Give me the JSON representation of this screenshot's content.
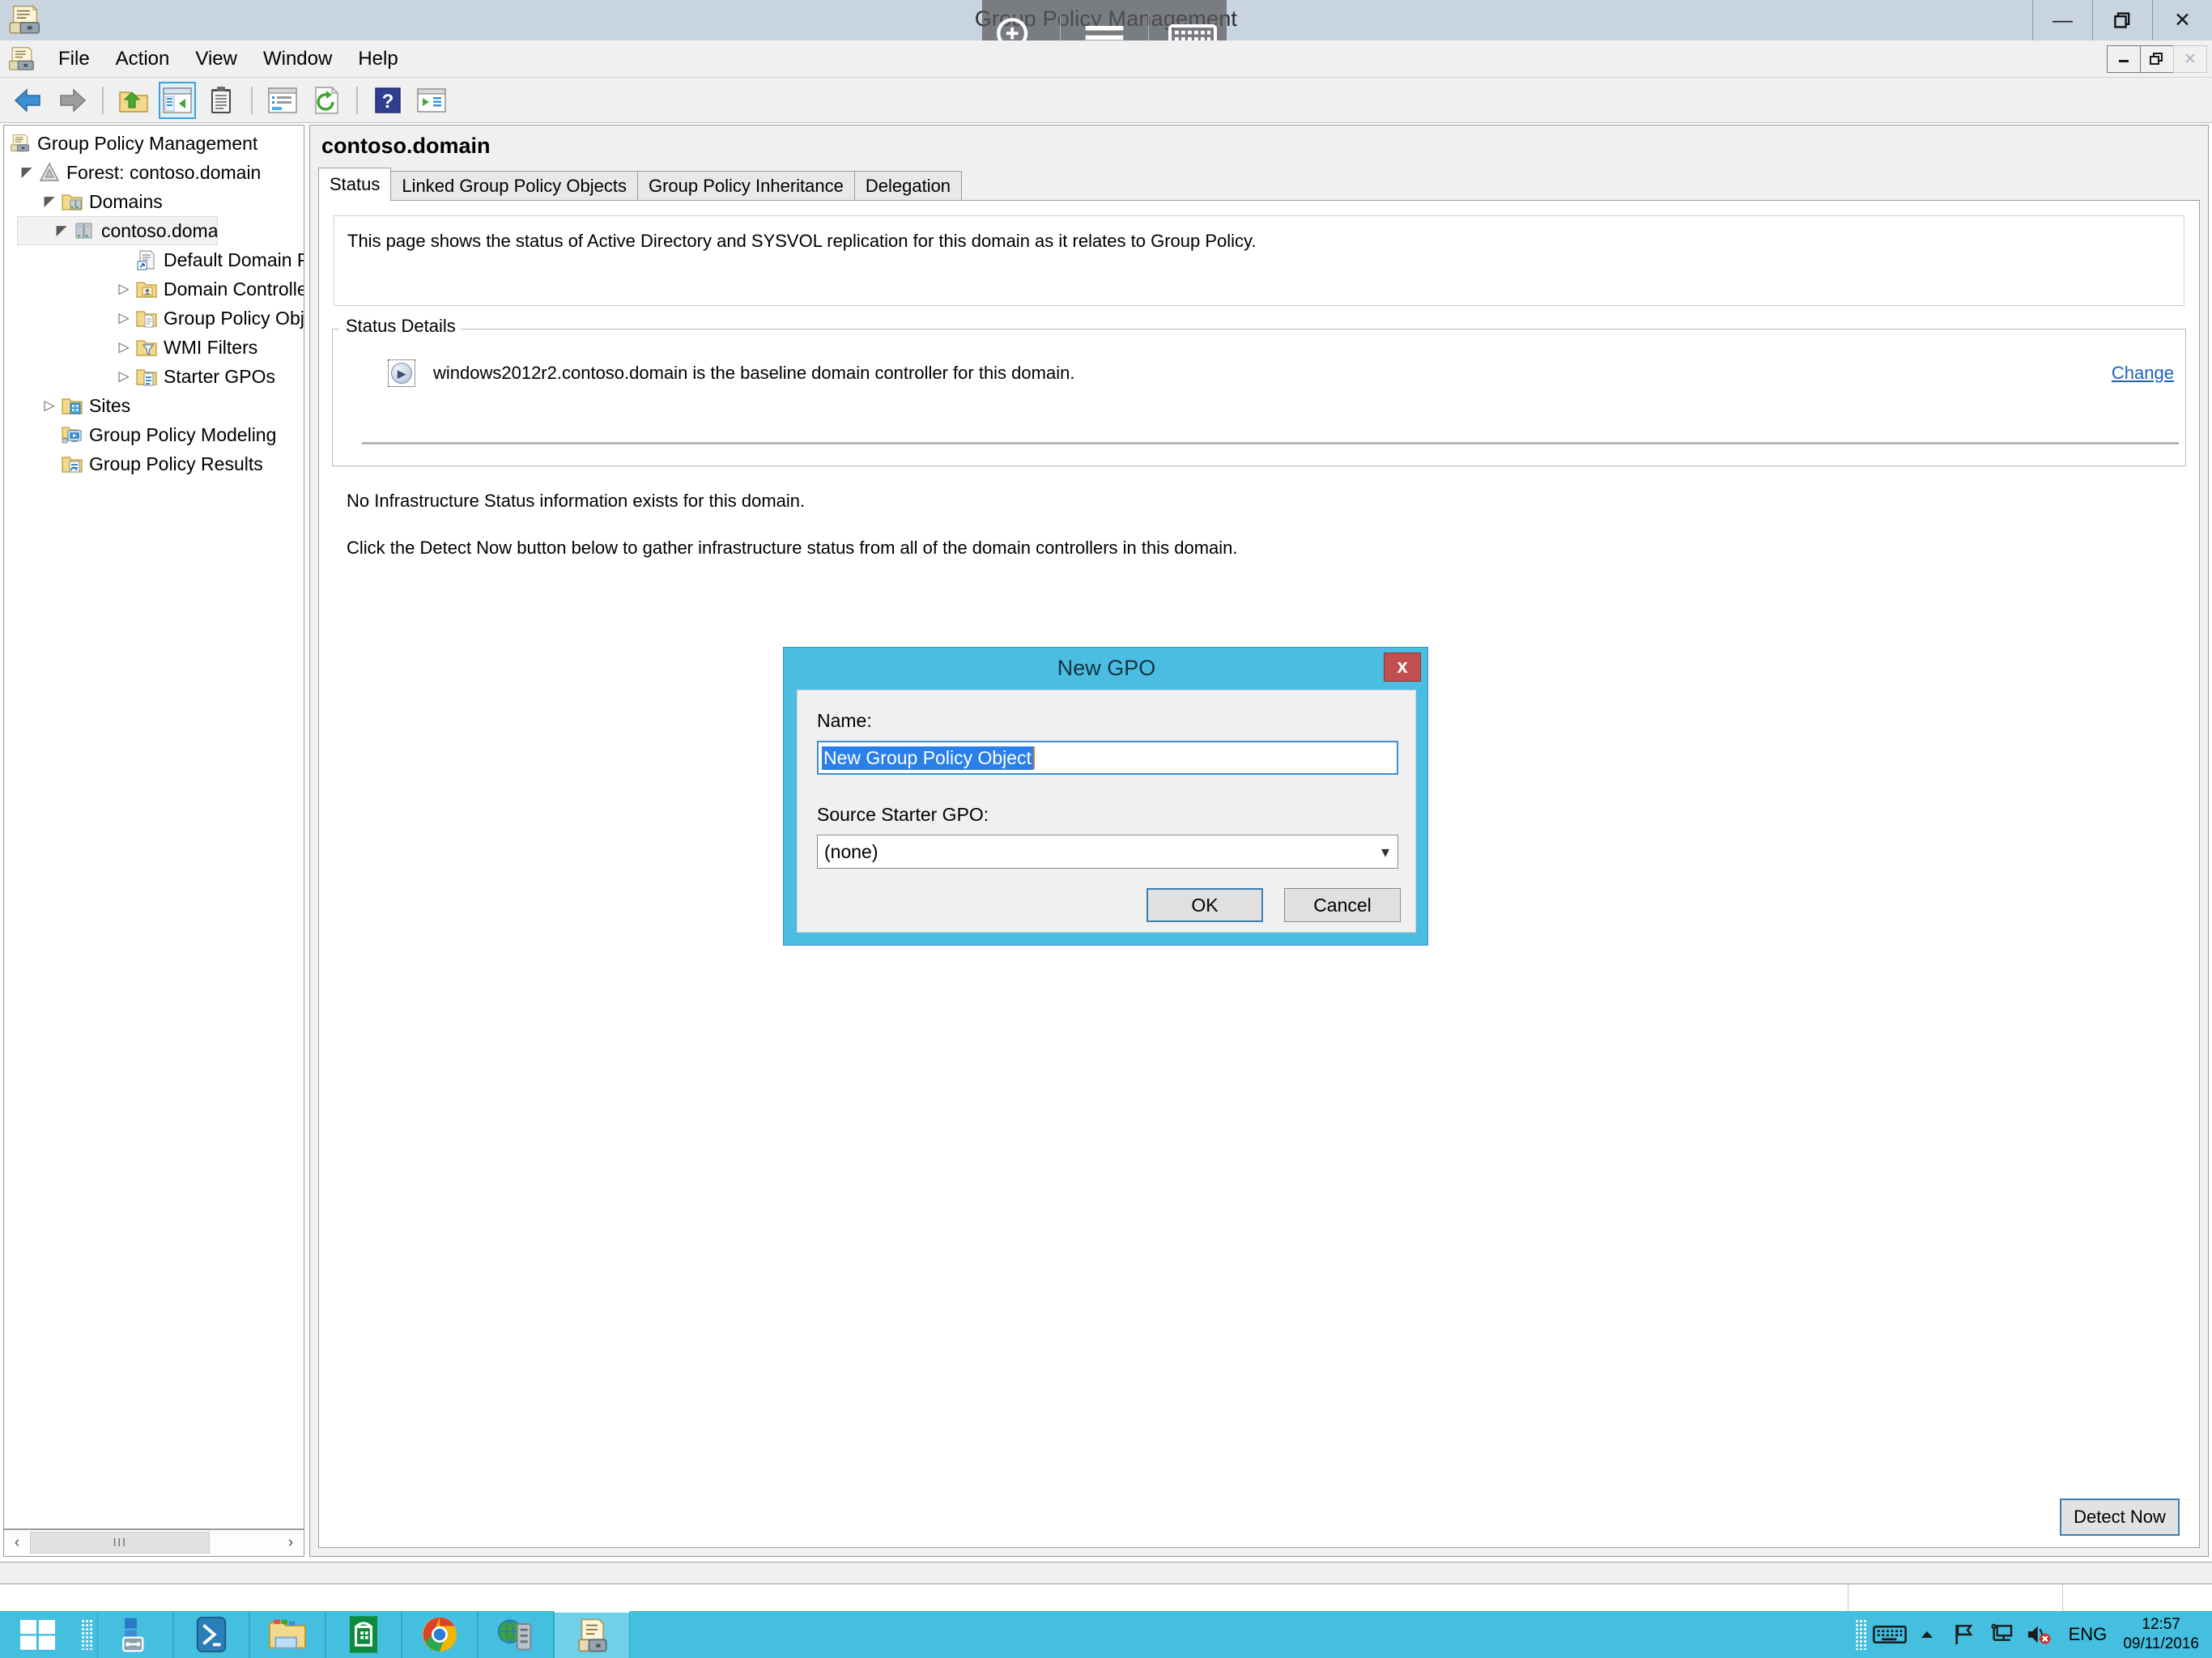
{
  "window": {
    "title": "Group Policy Management",
    "app_icon": "group-policy-scroll-icon",
    "controls": {
      "minimize": "—",
      "restore": "❐",
      "close": "✕"
    },
    "mdi_controls": {
      "minimize": "—",
      "restore": "❐",
      "close": "✕"
    }
  },
  "overlay_toolbar": {
    "items": [
      {
        "name": "magnifier-zoom-in-icon",
        "label": "Magnifier"
      },
      {
        "name": "hamburger-menu-icon",
        "label": "Menu"
      },
      {
        "name": "on-screen-keyboard-icon",
        "label": "On-Screen Keyboard"
      }
    ]
  },
  "menubar": {
    "items": [
      {
        "label": "File"
      },
      {
        "label": "Action"
      },
      {
        "label": "View"
      },
      {
        "label": "Window"
      },
      {
        "label": "Help"
      }
    ]
  },
  "toolbar": {
    "buttons": [
      {
        "name": "back-button",
        "icon": "arrow-left-icon",
        "enabled": true
      },
      {
        "name": "forward-button",
        "icon": "arrow-right-icon",
        "enabled": false
      },
      {
        "name": "up-one-level-button",
        "icon": "folder-up-icon"
      },
      {
        "name": "show-hide-console-tree-button",
        "icon": "console-tree-icon",
        "active": true
      },
      {
        "name": "properties-button",
        "icon": "clipboard-icon"
      },
      {
        "name": "show-hide-action-pane-button",
        "icon": "action-pane-icon"
      },
      {
        "name": "refresh-button",
        "icon": "refresh-icon"
      },
      {
        "name": "help-button",
        "icon": "help-question-icon"
      },
      {
        "name": "export-list-button",
        "icon": "export-list-icon"
      }
    ]
  },
  "tree": {
    "items": [
      {
        "label": "Group Policy Management",
        "depth": 0,
        "twisty": "",
        "icon": "gpm-scroll-icon",
        "selected": false
      },
      {
        "label": "Forest: contoso.domain",
        "depth": 1,
        "twisty": "expanded",
        "icon": "forest-triangle-icon",
        "selected": false
      },
      {
        "label": "Domains",
        "depth": 2,
        "twisty": "expanded",
        "icon": "domains-folder-icon",
        "selected": false
      },
      {
        "label": "contoso.domain",
        "depth": 3,
        "twisty": "expanded",
        "icon": "domain-server-icon",
        "selected": true
      },
      {
        "label": "Default Domain Policy",
        "depth": 4,
        "twisty": "",
        "icon": "gpo-link-icon",
        "selected": false
      },
      {
        "label": "Domain Controllers",
        "depth": 4,
        "twisty": "collapsed",
        "icon": "ou-folder-icon",
        "selected": false
      },
      {
        "label": "Group Policy Objects",
        "depth": 4,
        "twisty": "collapsed",
        "icon": "gpo-folder-icon",
        "selected": false
      },
      {
        "label": "WMI Filters",
        "depth": 4,
        "twisty": "collapsed",
        "icon": "wmi-filter-folder-icon",
        "selected": false
      },
      {
        "label": "Starter GPOs",
        "depth": 4,
        "twisty": "collapsed",
        "icon": "starter-gpo-folder-icon",
        "selected": false
      },
      {
        "label": "Sites",
        "depth": 2,
        "twisty": "collapsed",
        "icon": "sites-folder-icon",
        "selected": false
      },
      {
        "label": "Group Policy Modeling",
        "depth": 2,
        "twisty": "",
        "icon": "gp-modeling-icon",
        "selected": false
      },
      {
        "label": "Group Policy Results",
        "depth": 2,
        "twisty": "",
        "icon": "gp-results-icon",
        "selected": false
      }
    ],
    "hscrollbar": {
      "left_arrow": "‹",
      "right_arrow": "›",
      "thumb_grip": "III"
    }
  },
  "content": {
    "title": "contoso.domain",
    "tabs": [
      {
        "label": "Status",
        "active": true
      },
      {
        "label": "Linked Group Policy Objects",
        "active": false
      },
      {
        "label": "Group Policy Inheritance",
        "active": false
      },
      {
        "label": "Delegation",
        "active": false
      }
    ],
    "intro_text": "This page shows the status of Active Directory and SYSVOL replication for this domain as it relates to Group Policy.",
    "status_details": {
      "legend": "Status Details",
      "baseline_text": "windows2012r2.contoso.domain is the baseline domain controller for this domain.",
      "change_link": "Change"
    },
    "no_info_text": "No Infrastructure Status information exists for this domain.",
    "hint_text": "Click the Detect Now button below to gather infrastructure status from all of the domain controllers in this domain.",
    "detect_button": "Detect Now"
  },
  "dialog": {
    "title": "New GPO",
    "close_label": "x",
    "name_label": "Name:",
    "name_value": "New Group Policy Object",
    "source_label": "Source Starter GPO:",
    "source_value": "(none)",
    "source_options": [
      "(none)"
    ],
    "ok_label": "OK",
    "cancel_label": "Cancel",
    "colors": {
      "titlebar": "#4bbde3",
      "close": "#c0504d",
      "selection": "#2a7fe8"
    }
  },
  "taskbar": {
    "start_icon": "windows-logo-icon",
    "tasks": [
      {
        "name": "server-manager-icon",
        "running": false
      },
      {
        "name": "powershell-icon",
        "running": false
      },
      {
        "name": "file-explorer-icon",
        "running": false
      },
      {
        "name": "windows-store-icon",
        "running": false
      },
      {
        "name": "google-chrome-icon",
        "running": false
      },
      {
        "name": "network-globe-icon",
        "running": false
      },
      {
        "name": "group-policy-management-icon",
        "running": true
      }
    ],
    "tray": {
      "keyboard_icon": "on-screen-keyboard-icon",
      "show_hidden_icon": "chevron-up-icon",
      "flag_icon": "action-center-flag-icon",
      "network_icon": "network-icon",
      "volume_icon": "volume-muted-icon",
      "language": "ENG",
      "time": "12:57",
      "date": "09/11/2016"
    }
  }
}
